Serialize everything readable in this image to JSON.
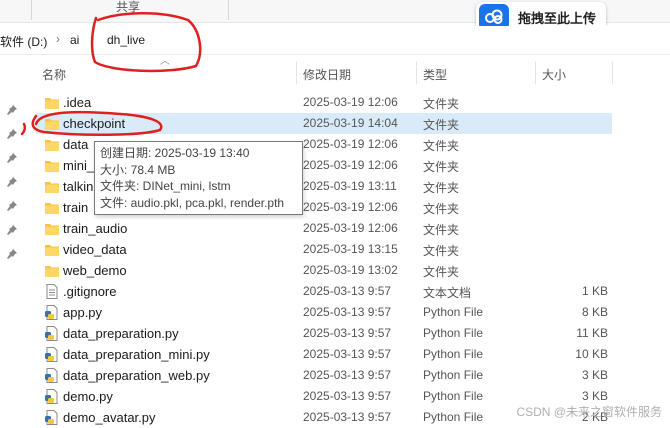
{
  "ribbon": {
    "share_label": "共享"
  },
  "upload": {
    "label": "拖拽至此上传",
    "icon": "cloud-icon",
    "color": "#1a73e8"
  },
  "address": {
    "crumbs": [
      "软件 (D:)",
      "ai",
      "dh_live"
    ]
  },
  "columns": {
    "name": "名称",
    "date": "修改日期",
    "type": "类型",
    "size": "大小"
  },
  "files": [
    {
      "name": ".idea",
      "date": "2025-03-19 12:06",
      "type": "文件夹",
      "size": "",
      "kind": "folder"
    },
    {
      "name": "checkpoint",
      "date": "2025-03-19 14:04",
      "type": "文件夹",
      "size": "",
      "kind": "folder",
      "selected": true
    },
    {
      "name": "data",
      "date": "2025-03-19 12:06",
      "type": "文件夹",
      "size": "",
      "kind": "folder"
    },
    {
      "name": "mini_",
      "date": "2025-03-19 12:06",
      "type": "文件夹",
      "size": "",
      "kind": "folder"
    },
    {
      "name": "talkin",
      "date": "2025-03-19 13:11",
      "type": "文件夹",
      "size": "",
      "kind": "folder"
    },
    {
      "name": "train",
      "date": "2025-03-19 12:06",
      "type": "文件夹",
      "size": "",
      "kind": "folder"
    },
    {
      "name": "train_audio",
      "date": "2025-03-19 12:06",
      "type": "文件夹",
      "size": "",
      "kind": "folder"
    },
    {
      "name": "video_data",
      "date": "2025-03-19 13:15",
      "type": "文件夹",
      "size": "",
      "kind": "folder"
    },
    {
      "name": "web_demo",
      "date": "2025-03-19 13:02",
      "type": "文件夹",
      "size": "",
      "kind": "folder"
    },
    {
      "name": ".gitignore",
      "date": "2025-03-13 9:57",
      "type": "文本文档",
      "size": "1 KB",
      "kind": "text"
    },
    {
      "name": "app.py",
      "date": "2025-03-13 9:57",
      "type": "Python File",
      "size": "8 KB",
      "kind": "python"
    },
    {
      "name": "data_preparation.py",
      "date": "2025-03-13 9:57",
      "type": "Python File",
      "size": "11 KB",
      "kind": "python"
    },
    {
      "name": "data_preparation_mini.py",
      "date": "2025-03-13 9:57",
      "type": "Python File",
      "size": "10 KB",
      "kind": "python"
    },
    {
      "name": "data_preparation_web.py",
      "date": "2025-03-13 9:57",
      "type": "Python File",
      "size": "3 KB",
      "kind": "python"
    },
    {
      "name": "demo.py",
      "date": "2025-03-13 9:57",
      "type": "Python File",
      "size": "3 KB",
      "kind": "python"
    },
    {
      "name": "demo_avatar.py",
      "date": "2025-03-13 9:57",
      "type": "Python File",
      "size": "2 KB",
      "kind": "python"
    }
  ],
  "tooltip": {
    "created": "创建日期: 2025-03-19 13:40",
    "size": "大小: 78.4 MB",
    "folders": "文件夹: DINet_mini, lstm",
    "files": "文件: audio.pkl, pca.pkl, render.pth"
  },
  "watermark": "CSDN @未来之窗软件服务",
  "colors": {
    "selection": "#d9ebf9",
    "folder": "#f5c542",
    "annotation": "#e02020"
  }
}
